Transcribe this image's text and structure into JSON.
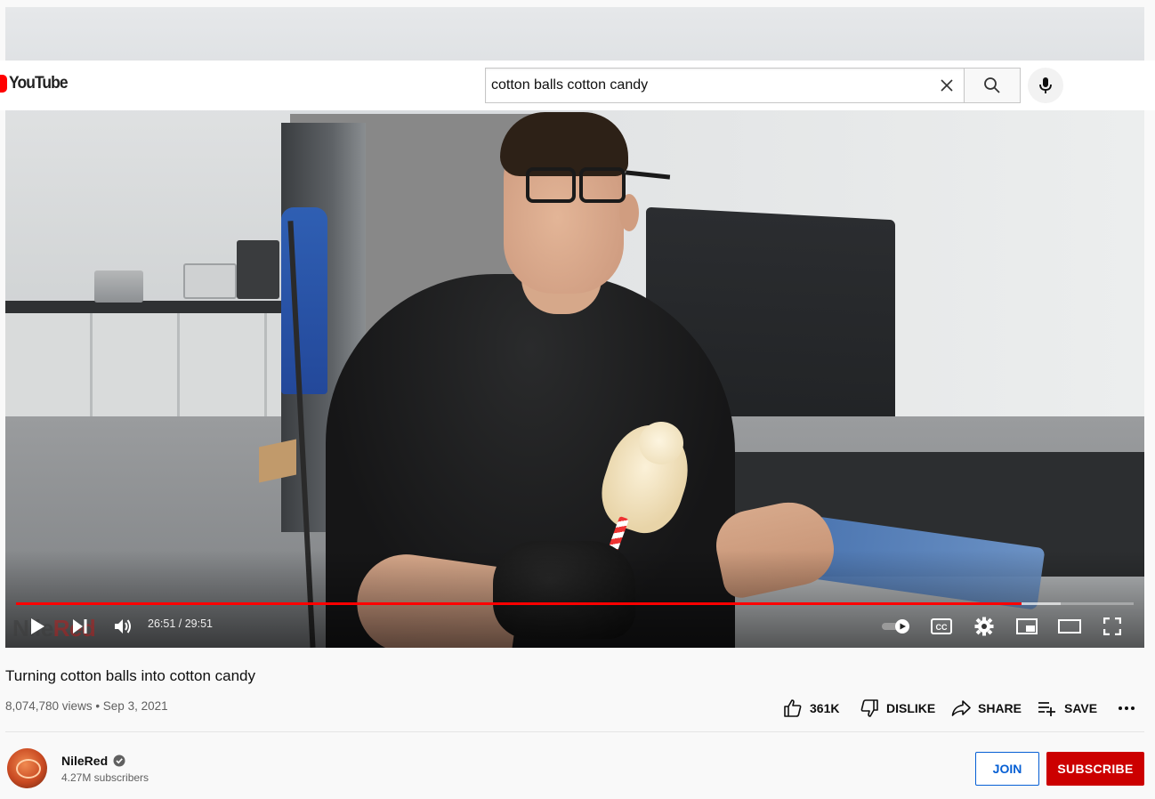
{
  "app": {
    "logo_text": "YouTube"
  },
  "search": {
    "query": "cotton balls cotton candy"
  },
  "player": {
    "current_time": "26:51",
    "duration": "29:51",
    "time_display": "26:51 / 29:51",
    "progress_played_fraction": 0.8995,
    "progress_buffered_fraction": 0.9345,
    "watermark_left": "Nile",
    "watermark_right": "Red"
  },
  "video": {
    "title": "Turning cotton balls into cotton candy",
    "meta": "8,074,780 views • Sep 3, 2021"
  },
  "actions": {
    "like_label": "361K",
    "dislike_label": "DISLIKE",
    "share_label": "SHARE",
    "save_label": "SAVE"
  },
  "channel": {
    "name": "NileRed",
    "subscribers": "4.27M subscribers",
    "join_label": "JOIN",
    "subscribe_label": "SUBSCRIBE"
  },
  "colors": {
    "brand_red": "#ff0000",
    "subscribe_red": "#cc0000",
    "join_blue": "#065fd4"
  }
}
